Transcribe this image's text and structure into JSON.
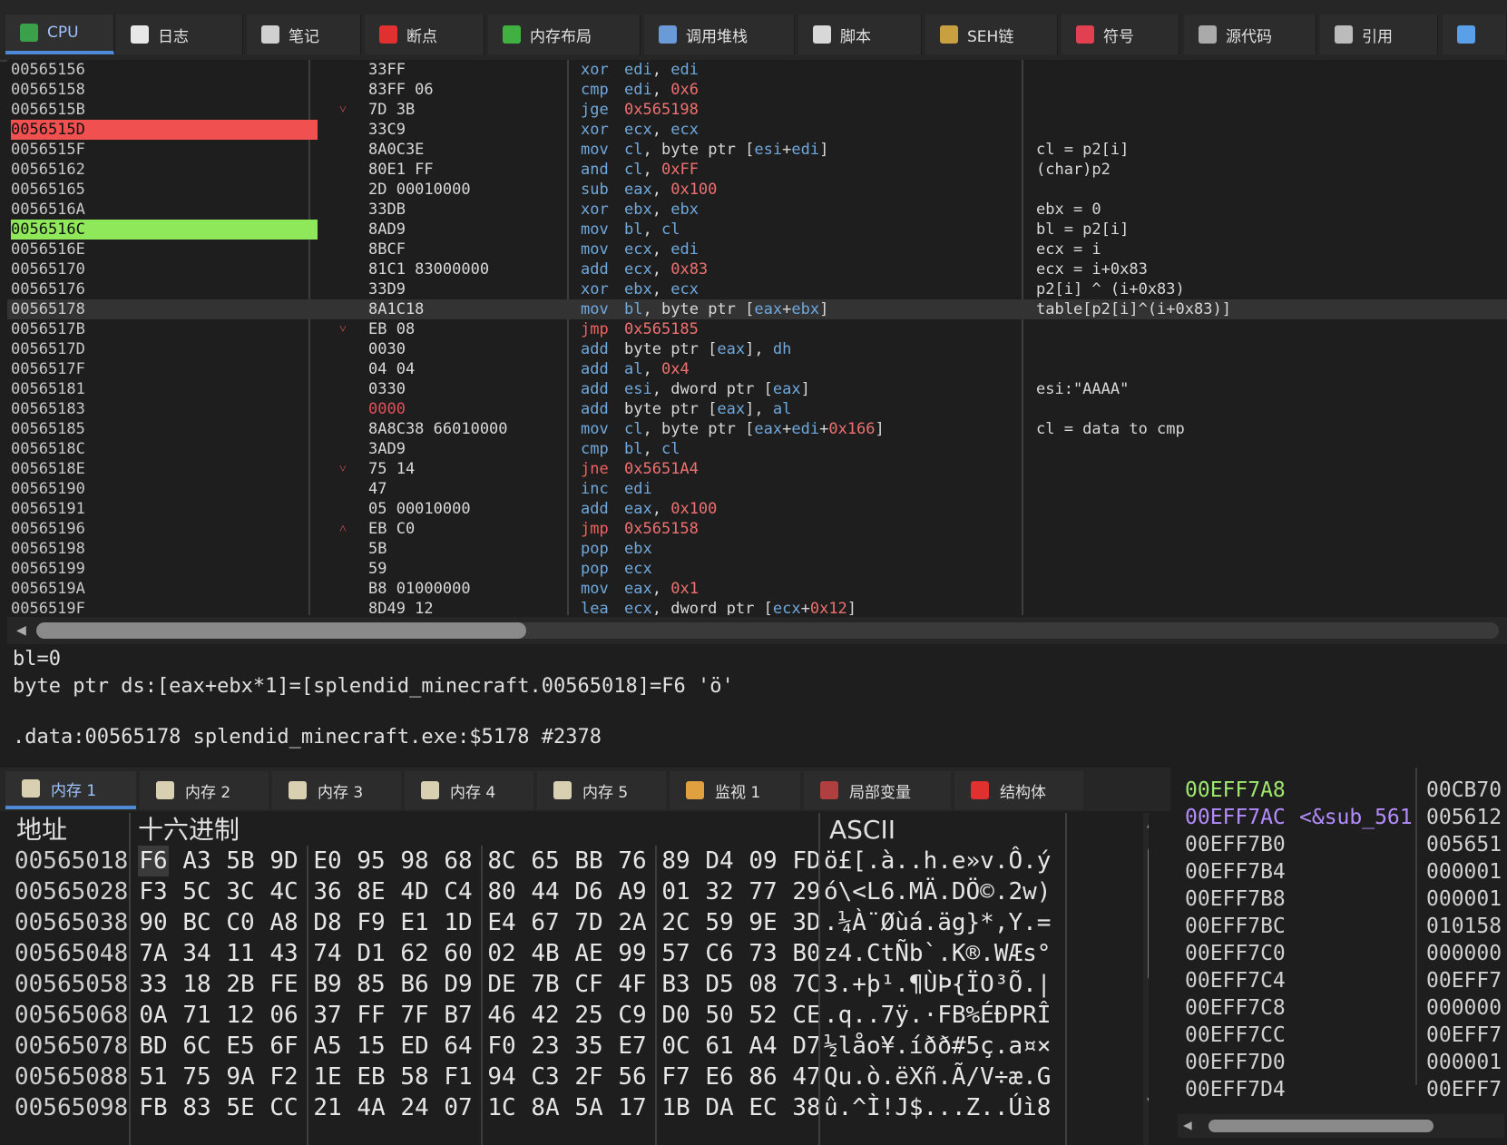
{
  "top_tabs": [
    {
      "label": "CPU",
      "icon": "cpu-icon",
      "color": "#3aa04a",
      "active": true
    },
    {
      "label": "日志",
      "icon": "log-icon",
      "color": "#e8e8e8"
    },
    {
      "label": "笔记",
      "icon": "notes-icon",
      "color": "#d0d0d0"
    },
    {
      "label": "断点",
      "icon": "breakpoint-icon",
      "color": "#e03030"
    },
    {
      "label": "内存布局",
      "icon": "memory-map-icon",
      "color": "#40b040"
    },
    {
      "label": "调用堆栈",
      "icon": "call-stack-icon",
      "color": "#6a9ad8"
    },
    {
      "label": "脚本",
      "icon": "script-icon",
      "color": "#d8d8d8"
    },
    {
      "label": "SEH链",
      "icon": "seh-chain-icon",
      "color": "#c8a040"
    },
    {
      "label": "符号",
      "icon": "symbols-icon",
      "color": "#e04050"
    },
    {
      "label": "源代码",
      "icon": "source-icon",
      "color": "#aaaaaa"
    },
    {
      "label": "引用",
      "icon": "references-icon",
      "color": "#bbbbbb"
    },
    {
      "label": "",
      "icon": "more-tabs-icon",
      "color": "#5aa0e8"
    }
  ],
  "disasm": [
    {
      "addr": "00565156",
      "bytes": "33FF",
      "mn": "xor",
      "ops": "edi, edi",
      "cmt": ""
    },
    {
      "addr": "00565158",
      "bytes": "83FF 06",
      "mn": "cmp",
      "ops": "edi, 0x6",
      "cmt": ""
    },
    {
      "addr": "0056515B",
      "arrow": "˅",
      "bytes": "7D 3B",
      "mn": "jge",
      "ops": "0x565198",
      "cmt": ""
    },
    {
      "addr": "0056515D",
      "mark": "red",
      "bytes": "33C9",
      "mn": "xor",
      "ops": "ecx, ecx",
      "cmt": ""
    },
    {
      "addr": "0056515F",
      "bytes": "8A0C3E",
      "mn": "mov",
      "ops": "cl, byte ptr [esi+edi]",
      "cmt": "cl = p2[i]"
    },
    {
      "addr": "00565162",
      "bytes": "80E1 FF",
      "mn": "and",
      "ops": "cl, 0xFF",
      "cmt": "(char)p2"
    },
    {
      "addr": "00565165",
      "bytes": "2D 00010000",
      "mn": "sub",
      "ops": "eax, 0x100",
      "cmt": ""
    },
    {
      "addr": "0056516A",
      "bytes": "33DB",
      "mn": "xor",
      "ops": "ebx, ebx",
      "cmt": "ebx = 0"
    },
    {
      "addr": "0056516C",
      "mark": "green",
      "bytes": "8AD9",
      "mn": "mov",
      "ops": "bl, cl",
      "cmt": "bl = p2[i]"
    },
    {
      "addr": "0056516E",
      "bytes": "8BCF",
      "mn": "mov",
      "ops": "ecx, edi",
      "cmt": "ecx = i"
    },
    {
      "addr": "00565170",
      "bytes": "81C1 83000000",
      "mn": "add",
      "ops": "ecx, 0x83",
      "cmt": "ecx = i+0x83"
    },
    {
      "addr": "00565176",
      "bytes": "33D9",
      "mn": "xor",
      "ops": "ebx, ecx",
      "cmt": "p2[i] ^ (i+0x83)"
    },
    {
      "addr": "00565178",
      "current": true,
      "bytes": "8A1C18",
      "mn": "mov",
      "ops": "bl, byte ptr [eax+ebx]",
      "cmt": "table[p2[i]^(i+0x83)]"
    },
    {
      "addr": "0056517B",
      "arrow": "˅",
      "bytes": "EB 08",
      "mn": "jmp",
      "jump": true,
      "ops": "0x565185",
      "cmt": ""
    },
    {
      "addr": "0056517D",
      "bytes": "0030",
      "mn": "add",
      "ops": "byte ptr [eax], dh",
      "cmt": ""
    },
    {
      "addr": "0056517F",
      "bytes": "04 04",
      "mn": "add",
      "ops": "al, 0x4",
      "cmt": ""
    },
    {
      "addr": "00565181",
      "bytes": "0330",
      "mn": "add",
      "ops": "esi, dword ptr [eax]",
      "cmt": "esi:\"AAAA\""
    },
    {
      "addr": "00565183",
      "bytes": "0000",
      "bytes_red": true,
      "mn": "add",
      "ops": "byte ptr [eax], al",
      "cmt": ""
    },
    {
      "addr": "00565185",
      "bytes": "8A8C38 66010000",
      "mn": "mov",
      "ops": "cl, byte ptr [eax+edi+0x166]",
      "cmt": "cl = data to cmp"
    },
    {
      "addr": "0056518C",
      "bytes": "3AD9",
      "mn": "cmp",
      "ops": "bl, cl",
      "cmt": ""
    },
    {
      "addr": "0056518E",
      "arrow": "˅",
      "bytes": "75 14",
      "mn": "jne",
      "jump": true,
      "ops": "0x5651A4",
      "cmt": ""
    },
    {
      "addr": "00565190",
      "bytes": "47",
      "mn": "inc",
      "ops": "edi",
      "cmt": ""
    },
    {
      "addr": "00565191",
      "bytes": "05 00010000",
      "mn": "add",
      "ops": "eax, 0x100",
      "cmt": ""
    },
    {
      "addr": "00565196",
      "arrow": "˄",
      "bytes": "EB C0",
      "mn": "jmp",
      "jump": true,
      "ops": "0x565158",
      "cmt": ""
    },
    {
      "addr": "00565198",
      "bytes": "5B",
      "mn": "pop",
      "ops": "ebx",
      "cmt": ""
    },
    {
      "addr": "00565199",
      "bytes": "59",
      "mn": "pop",
      "ops": "ecx",
      "cmt": ""
    },
    {
      "addr": "0056519A",
      "bytes": "B8 01000000",
      "mn": "mov",
      "ops": "eax, 0x1",
      "cmt": ""
    },
    {
      "addr": "0056519F",
      "bytes": "8D49 12",
      "mn": "lea",
      "ops": "ecx, dword ptr [ecx+0x12]",
      "cmt": ""
    }
  ],
  "info": {
    "line1": "bl=0",
    "line2": "byte ptr ds:[eax+ebx*1]=[splendid_minecraft.00565018]=F6 'ö'",
    "line3": ".data:00565178 splendid_minecraft.exe:$5178 #2378"
  },
  "mem_tabs": [
    {
      "label": "内存 1",
      "icon": "memory-dump-icon",
      "active": true
    },
    {
      "label": "内存 2",
      "icon": "memory-dump-icon"
    },
    {
      "label": "内存 3",
      "icon": "memory-dump-icon"
    },
    {
      "label": "内存 4",
      "icon": "memory-dump-icon"
    },
    {
      "label": "内存 5",
      "icon": "memory-dump-icon"
    },
    {
      "label": "监视 1",
      "icon": "watch-icon"
    },
    {
      "label": "局部变量",
      "icon": "locals-icon"
    },
    {
      "label": "结构体",
      "icon": "struct-icon"
    }
  ],
  "hex": {
    "headers": {
      "addr": "地址",
      "hex": "十六进制",
      "ascii": "ASCII"
    },
    "rows": [
      {
        "addr": "00565018",
        "bytes": [
          "F6",
          "A3",
          "5B",
          "9D",
          "E0",
          "95",
          "98",
          "68",
          "8C",
          "65",
          "BB",
          "76",
          "89",
          "D4",
          "09",
          "FD"
        ],
        "ascii": "ö£[.à..h.e»v.Ô.ý"
      },
      {
        "addr": "00565028",
        "bytes": [
          "F3",
          "5C",
          "3C",
          "4C",
          "36",
          "8E",
          "4D",
          "C4",
          "80",
          "44",
          "D6",
          "A9",
          "01",
          "32",
          "77",
          "29"
        ],
        "ascii": "ó\\<L6.MÄ.DÖ©.2w)"
      },
      {
        "addr": "00565038",
        "bytes": [
          "90",
          "BC",
          "C0",
          "A8",
          "D8",
          "F9",
          "E1",
          "1D",
          "E4",
          "67",
          "7D",
          "2A",
          "2C",
          "59",
          "9E",
          "3D"
        ],
        "ascii": ".¼À¨Øùá.äg}*,Y.="
      },
      {
        "addr": "00565048",
        "bytes": [
          "7A",
          "34",
          "11",
          "43",
          "74",
          "D1",
          "62",
          "60",
          "02",
          "4B",
          "AE",
          "99",
          "57",
          "C6",
          "73",
          "B0"
        ],
        "ascii": "z4.CtÑb`.K®.WÆs°"
      },
      {
        "addr": "00565058",
        "bytes": [
          "33",
          "18",
          "2B",
          "FE",
          "B9",
          "85",
          "B6",
          "D9",
          "DE",
          "7B",
          "CF",
          "4F",
          "B3",
          "D5",
          "08",
          "7C"
        ],
        "ascii": "3.+þ¹.¶ÙÞ{ÏO³Õ.|"
      },
      {
        "addr": "00565068",
        "bytes": [
          "0A",
          "71",
          "12",
          "06",
          "37",
          "FF",
          "7F",
          "B7",
          "46",
          "42",
          "25",
          "C9",
          "D0",
          "50",
          "52",
          "CE"
        ],
        "ascii": ".q..7ÿ.·FB%ÉÐPRÎ"
      },
      {
        "addr": "00565078",
        "bytes": [
          "BD",
          "6C",
          "E5",
          "6F",
          "A5",
          "15",
          "ED",
          "64",
          "F0",
          "23",
          "35",
          "E7",
          "0C",
          "61",
          "A4",
          "D7"
        ],
        "ascii": "½låo¥.íðð#5ç.a¤×"
      },
      {
        "addr": "00565088",
        "bytes": [
          "51",
          "75",
          "9A",
          "F2",
          "1E",
          "EB",
          "58",
          "F1",
          "94",
          "C3",
          "2F",
          "56",
          "F7",
          "E6",
          "86",
          "47"
        ],
        "ascii": "Qu.ò.ëXñ.Ã/V÷æ.G"
      },
      {
        "addr": "00565098",
        "bytes": [
          "FB",
          "83",
          "5E",
          "CC",
          "21",
          "4A",
          "24",
          "07",
          "1C",
          "8A",
          "5A",
          "17",
          "1B",
          "DA",
          "EC",
          "38"
        ],
        "ascii": "û.^Ì!J$...Z..Úì8"
      }
    ]
  },
  "stack": [
    {
      "addr": "00EFF7A8",
      "sym": "",
      "val": "00CB70",
      "cur": true
    },
    {
      "addr": "00EFF7AC",
      "sym": "<&sub_561",
      "val": "005612",
      "ret": true
    },
    {
      "addr": "00EFF7B0",
      "sym": "",
      "val": "005651"
    },
    {
      "addr": "00EFF7B4",
      "sym": "",
      "val": "000001"
    },
    {
      "addr": "00EFF7B8",
      "sym": "",
      "val": "000001"
    },
    {
      "addr": "00EFF7BC",
      "sym": "",
      "val": "010158"
    },
    {
      "addr": "00EFF7C0",
      "sym": "",
      "val": "000000"
    },
    {
      "addr": "00EFF7C4",
      "sym": "",
      "val": "00EFF7"
    },
    {
      "addr": "00EFF7C8",
      "sym": "",
      "val": "000000"
    },
    {
      "addr": "00EFF7CC",
      "sym": "",
      "val": "00EFF7"
    },
    {
      "addr": "00EFF7D0",
      "sym": "",
      "val": "000001"
    },
    {
      "addr": "00EFF7D4",
      "sym": "",
      "val": "00EFF7"
    }
  ]
}
